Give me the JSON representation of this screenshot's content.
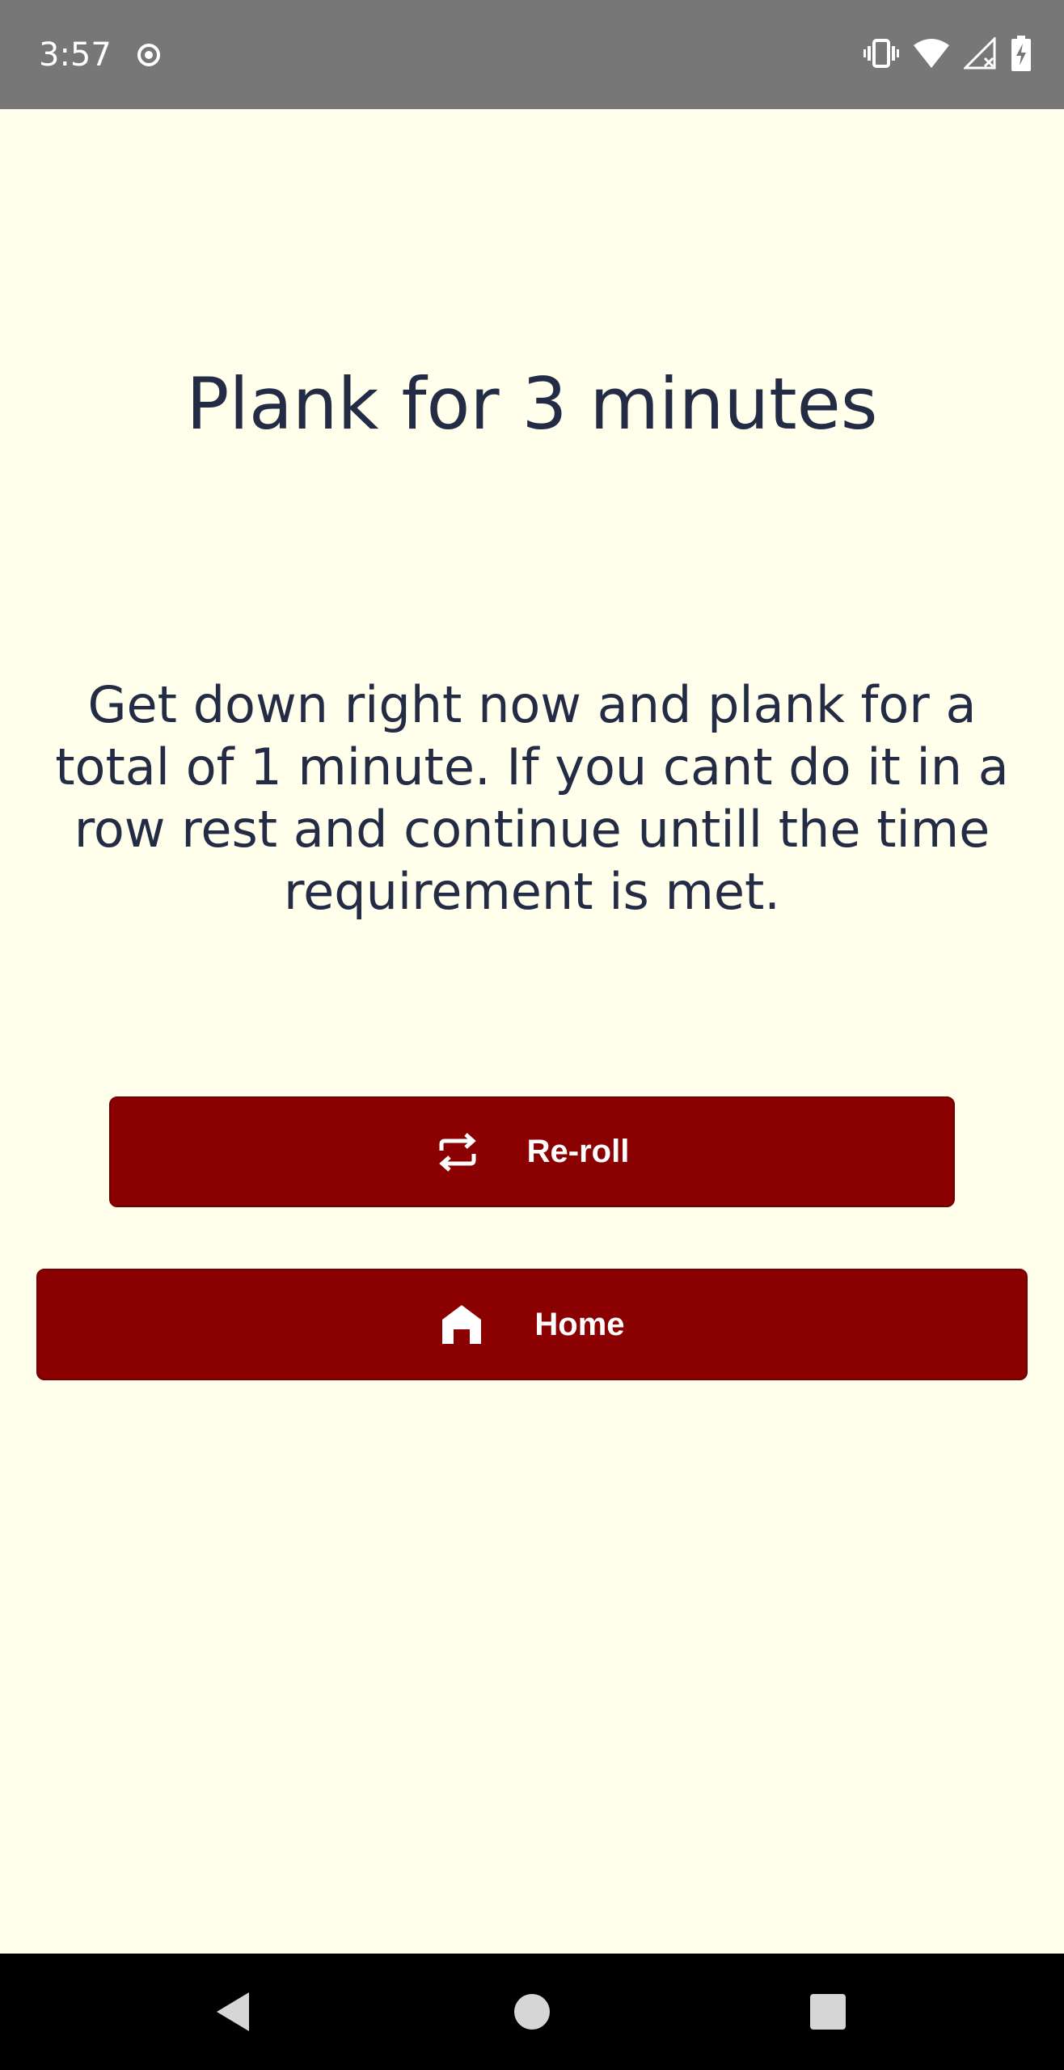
{
  "status_bar": {
    "time": "3:57",
    "icons": [
      "record-icon",
      "vibrate-icon",
      "wifi-icon",
      "signal-icon",
      "battery-icon"
    ]
  },
  "screen": {
    "title": "Plank for 3 minutes",
    "description": "Get down right now and plank for a total of 1 minute. If you cant do it in a row rest and continue untill the time requirement is met."
  },
  "buttons": {
    "reroll": {
      "label": "Re-roll",
      "icon": "repeat-icon"
    },
    "home": {
      "label": "Home",
      "icon": "home-icon"
    }
  },
  "nav_bar": {
    "icons": [
      "back-icon",
      "home-circle-icon",
      "recents-icon"
    ]
  },
  "colors": {
    "background": "#FFFFEB",
    "text": "#232B45",
    "button": "#8B0000",
    "status_bar": "#777777"
  }
}
